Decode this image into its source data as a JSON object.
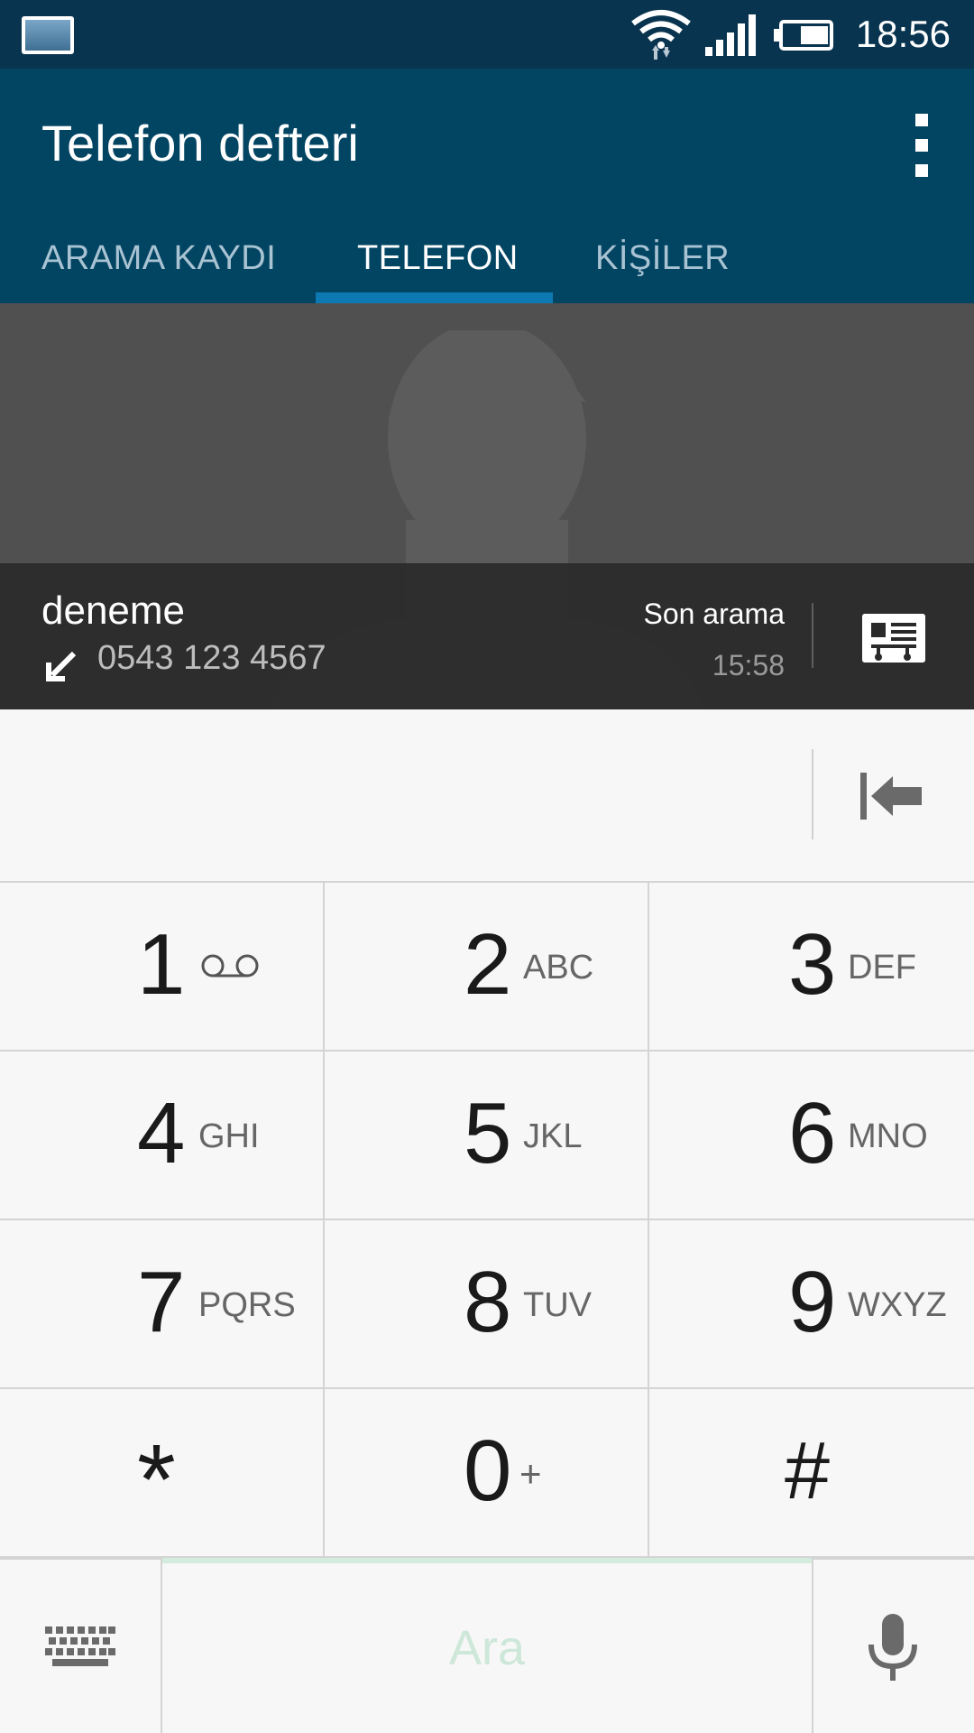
{
  "status_bar": {
    "time": "18:56",
    "notification_icon": "gallery-icon",
    "icons": [
      "wifi-icon",
      "signal-icon",
      "battery-icon"
    ]
  },
  "app_bar": {
    "title": "Telefon defteri",
    "overflow_icon": "more-vert-icon"
  },
  "tabs": [
    {
      "label": "ARAMA KAYDI",
      "active": false
    },
    {
      "label": "TELEFON",
      "active": true
    },
    {
      "label": "KİŞİLER",
      "active": false
    }
  ],
  "contact": {
    "name": "deneme",
    "number": "0543 123 4567",
    "last_call_label": "Son arama",
    "last_call_time": "15:58",
    "call_direction_icon": "incoming-call-icon",
    "card_icon": "contact-card-icon"
  },
  "entry": {
    "value": "",
    "backspace_icon": "backspace-icon"
  },
  "keypad": [
    {
      "digit": "1",
      "letters": ""
    },
    {
      "digit": "2",
      "letters": "ABC"
    },
    {
      "digit": "3",
      "letters": "DEF"
    },
    {
      "digit": "4",
      "letters": "GHI"
    },
    {
      "digit": "5",
      "letters": "JKL"
    },
    {
      "digit": "6",
      "letters": "MNO"
    },
    {
      "digit": "7",
      "letters": "PQRS"
    },
    {
      "digit": "8",
      "letters": "TUV"
    },
    {
      "digit": "9",
      "letters": "WXYZ"
    },
    {
      "digit": "*",
      "letters": ""
    },
    {
      "digit": "0",
      "letters": "+"
    },
    {
      "digit": "#",
      "letters": ""
    }
  ],
  "bottom": {
    "call_label": "Ara",
    "keyboard_icon": "keyboard-icon",
    "mic_icon": "mic-icon"
  },
  "colors": {
    "status_bar": "#08344f",
    "app_bar": "#024563",
    "tab_indicator": "#0d79b2",
    "call_accent": "#d3ecde"
  }
}
